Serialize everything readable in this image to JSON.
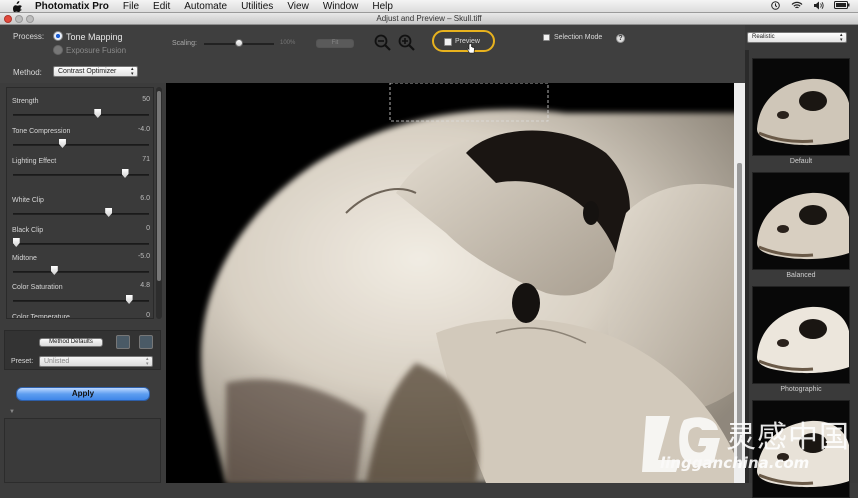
{
  "menubar": {
    "app_name": "Photomatix Pro",
    "items": [
      "File",
      "Edit",
      "Automate",
      "Utilities",
      "View",
      "Window",
      "Help"
    ]
  },
  "window": {
    "title": "Adjust and Preview – Skull.tiff"
  },
  "toolbar": {
    "process_label": "Process:",
    "tone_mapping": "Tone Mapping",
    "exposure_fusion": "Exposure Fusion",
    "method_label": "Method:",
    "method_value": "Contrast Optimizer",
    "scaling_label": "Scaling:",
    "scaling_value": "100%",
    "fit_label": "Fit",
    "preview_label": "Preview",
    "selection_mode_label": "Selection Mode",
    "help_glyph": "?",
    "preset_style": "Realistic"
  },
  "sliders": [
    {
      "name": "Strength",
      "value": "50",
      "fraction": 0.62
    },
    {
      "name": "Tone Compression",
      "value": "-4.0",
      "fraction": 0.36
    },
    {
      "name": "Lighting Effect",
      "value": "71",
      "fraction": 0.82
    },
    {
      "name": "White Clip",
      "value": "6.0",
      "fraction": 0.7
    },
    {
      "name": "Black Clip",
      "value": "0",
      "fraction": 0.02
    },
    {
      "name": "Midtone",
      "value": "-5.0",
      "fraction": 0.3
    },
    {
      "name": "Color Saturation",
      "value": "4.8",
      "fraction": 0.85
    },
    {
      "name": "Color Temperature",
      "value": "0",
      "fraction": 0.5
    }
  ],
  "lower": {
    "method_defaults": "Method Defaults",
    "preset_label": "Preset:",
    "preset_value": "Unlisted",
    "apply_label": "Apply"
  },
  "thumbnails": [
    {
      "caption": "Default"
    },
    {
      "caption": "Balanced"
    },
    {
      "caption": "Photographic"
    },
    {
      "caption": ""
    }
  ],
  "watermark": {
    "text_cn": "灵感中国",
    "url": "lingganchina.com"
  },
  "colors": {
    "accent_blue": "#3f86e8",
    "highlight_ring": "#e8b21e",
    "panel_bg": "#3c3c3c"
  }
}
